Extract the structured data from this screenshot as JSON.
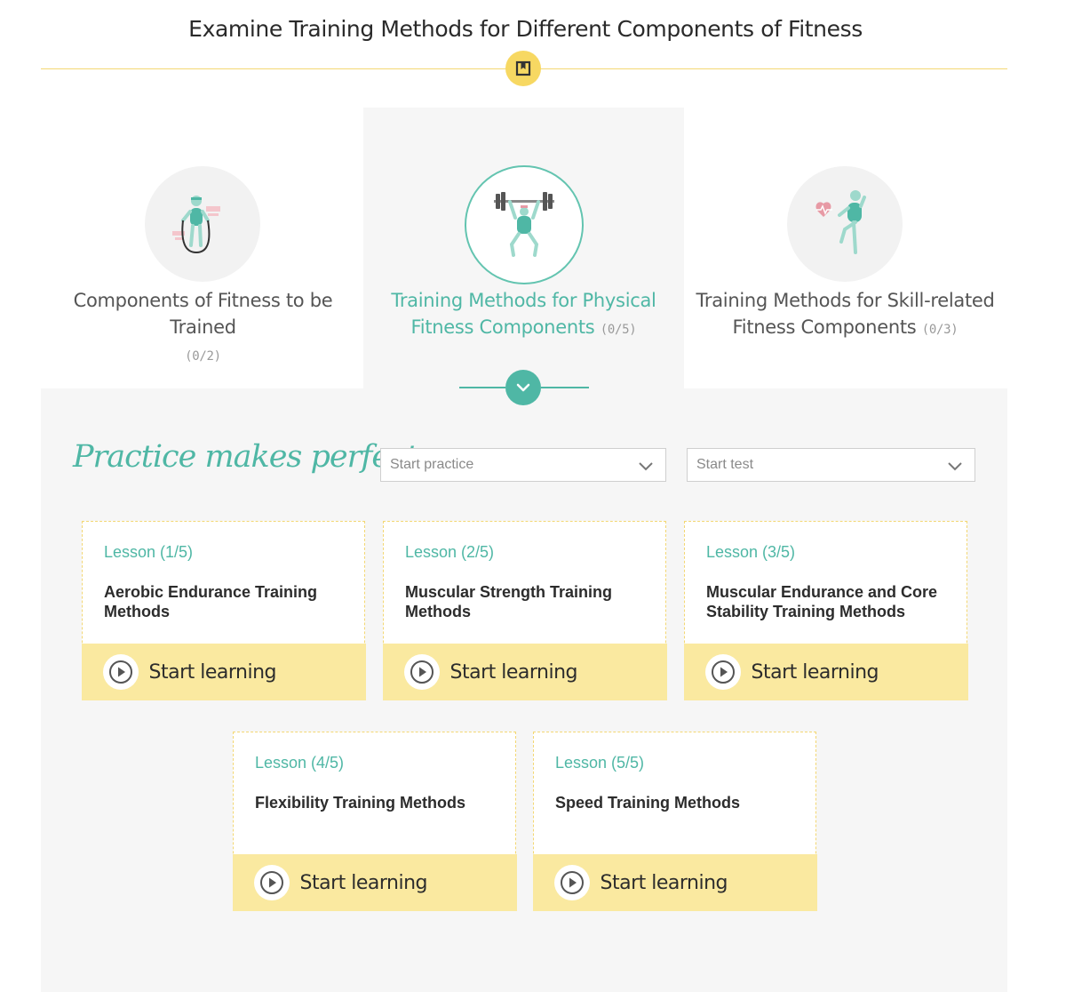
{
  "header": {
    "title": "Examine Training Methods for Different Components of Fitness"
  },
  "topics": [
    {
      "label": "Components of Fitness to be Trained",
      "count": "(0/2)",
      "icon": "jump-rope-icon"
    },
    {
      "label": "Training Methods for Physical Fitness Components",
      "count": "(0/5)",
      "icon": "weightlifter-icon"
    },
    {
      "label": "Training Methods for Skill-related Fitness Components",
      "count": "(0/3)",
      "icon": "heart-balance-icon"
    }
  ],
  "practice": {
    "heading": "Practice makes perfect:",
    "practice_placeholder": "Start practice",
    "test_placeholder": "Start test"
  },
  "lessons": [
    {
      "number": "Lesson (1/5)",
      "title": "Aerobic Endurance Training Methods",
      "action": "Start learning"
    },
    {
      "number": "Lesson (2/5)",
      "title": "Muscular Strength Training Methods",
      "action": "Start learning"
    },
    {
      "number": "Lesson (3/5)",
      "title": "Muscular Endurance and Core Stability Training Methods",
      "action": "Start learning"
    },
    {
      "number": "Lesson (4/5)",
      "title": "Flexibility Training Methods",
      "action": "Start learning"
    },
    {
      "number": "Lesson (5/5)",
      "title": "Speed Training Methods",
      "action": "Start learning"
    }
  ],
  "colors": {
    "accent": "#4fb7a5",
    "highlight": "#fae9a0",
    "badge": "#f7d862"
  }
}
